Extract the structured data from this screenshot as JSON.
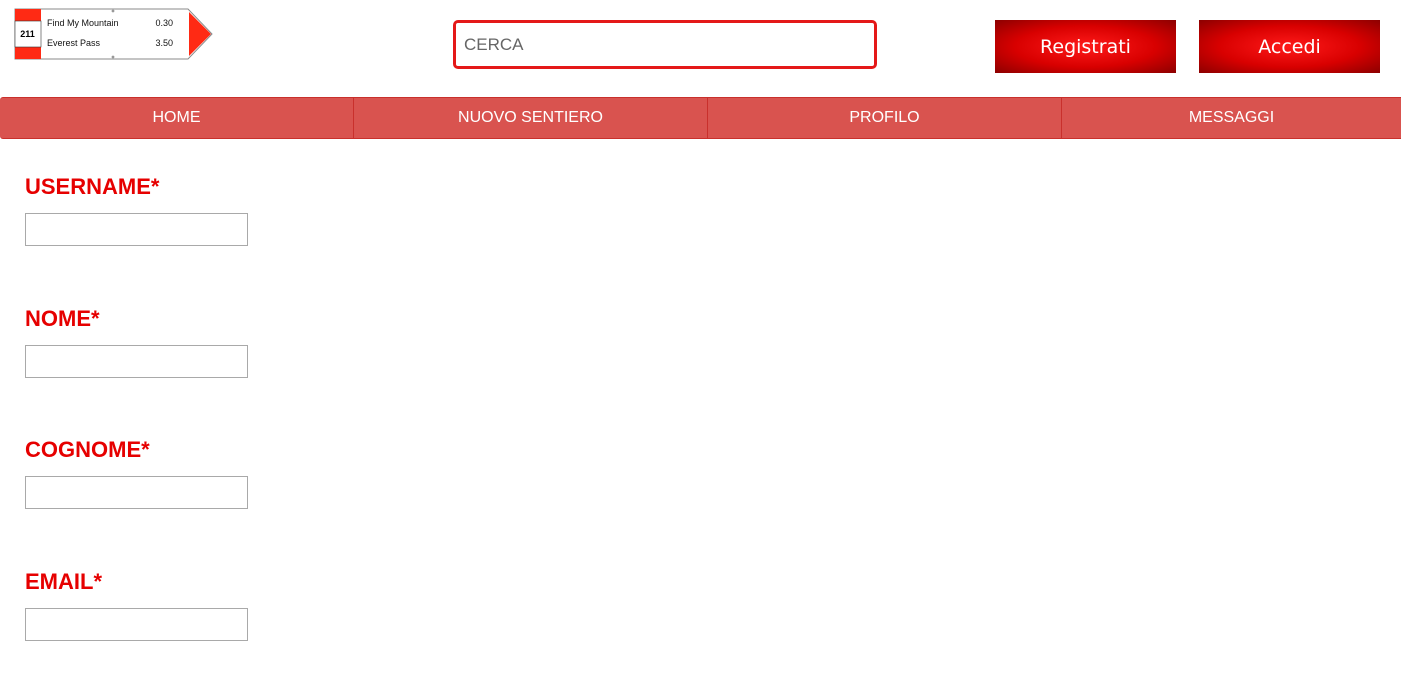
{
  "logo": {
    "number": "211",
    "rows": [
      {
        "destination": "Find My Mountain",
        "time": "0.30"
      },
      {
        "destination": "Everest Pass",
        "time": "3.50"
      }
    ],
    "colors": {
      "accent": "#ff2a14"
    }
  },
  "search": {
    "placeholder": "CERCA",
    "value": ""
  },
  "header": {
    "register_label": "Registrati",
    "login_label": "Accedi"
  },
  "nav": {
    "items": [
      {
        "label": "HOME"
      },
      {
        "label": "NUOVO SENTIERO"
      },
      {
        "label": "PROFILO"
      },
      {
        "label": "MESSAGGI"
      }
    ]
  },
  "form": {
    "fields": [
      {
        "label": "USERNAME*",
        "value": ""
      },
      {
        "label": "NOME*",
        "value": ""
      },
      {
        "label": "COGNOME*",
        "value": ""
      },
      {
        "label": "EMAIL*",
        "value": ""
      }
    ]
  },
  "colors": {
    "brand_red": "#e60000",
    "nav_bg": "#d9534f",
    "search_border": "#e41818"
  }
}
